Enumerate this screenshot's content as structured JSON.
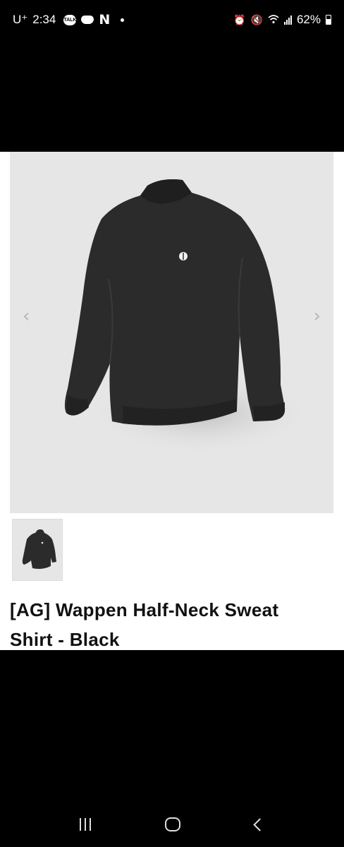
{
  "status_bar": {
    "carrier": "U⁺",
    "time": "2:34",
    "battery": "62%"
  },
  "product": {
    "title": "[AG] Wappen Half-Neck Sweat Shirt - Black",
    "prev_arrow": "‹",
    "next_arrow": "›"
  },
  "icons": {
    "talk": "TALK"
  },
  "colors": {
    "image_bg": "#e6e6e6",
    "sweatshirt": "#2a2a2a"
  }
}
